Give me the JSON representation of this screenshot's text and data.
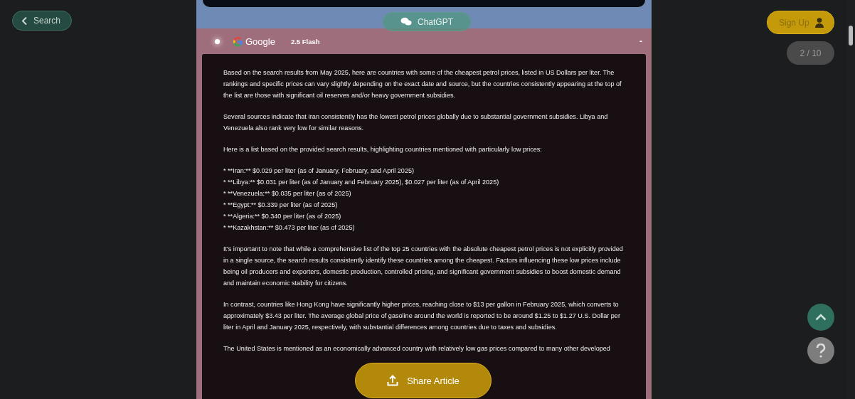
{
  "back_button": {
    "label": "Search"
  },
  "model_tab": {
    "label": "ChatGPT"
  },
  "response_header": {
    "provider": "Google",
    "model": "2.5 Flash",
    "collapse": "-"
  },
  "response_blocks": [
    {
      "kind": "paragraph",
      "text": "Based on the search results from May 2025, here are countries with some of the cheapest petrol prices, listed in US Dollars per liter. The rankings and specific prices can vary slightly depending on the exact date and source, but the countries consistently appearing at the top of the list are those with significant oil reserves and/or heavy government subsidies."
    },
    {
      "kind": "paragraph",
      "text": "Several sources indicate that Iran consistently has the lowest petrol prices globally due to substantial government subsidies. Libya and Venezuela also rank very low for similar reasons."
    },
    {
      "kind": "paragraph",
      "text": "Here is a list based on the provided search results, highlighting countries mentioned with particularly low prices:"
    },
    {
      "kind": "list",
      "items": [
        "* **Iran:** $0.029 per liter (as of January, February, and April 2025)",
        "* **Libya:** $0.031 per liter (as of January and February 2025), $0.027 per liter (as of April 2025)",
        "* **Venezuela:** $0.035 per liter (as of 2025)",
        "* **Egypt:** $0.339 per liter (as of 2025)",
        "* **Algeria:** $0.340 per liter (as of 2025)",
        "* **Kazakhstan:** $0.473 per liter (as of 2025)"
      ]
    },
    {
      "kind": "paragraph",
      "text": "It's important to note that while a comprehensive list of the top 25 countries with the absolute cheapest petrol prices is not explicitly provided in a single source, the search results consistently identify these countries among the cheapest. Factors influencing these low prices include being oil producers and exporters, domestic production, controlled pricing, and significant government subsidies to boost domestic demand and maintain economic stability for citizens."
    },
    {
      "kind": "paragraph",
      "text": "In contrast, countries like Hong Kong have significantly higher prices, reaching close to $13 per gallon in February 2025, which converts to approximately $3.43 per liter. The average global price of gasoline around the world is reported to be around $1.25 to $1.27 U.S. Dollar per liter in April and January 2025, respectively, with substantial differences among countries due to taxes and subsidies."
    },
    {
      "kind": "paragraph",
      "text": "The United States is mentioned as an economically advanced country with relatively low gas prices compared to many other developed"
    }
  ],
  "sign_up_button": {
    "label": "Sign Up"
  },
  "page_counter": "2 / 10",
  "share_button": {
    "label": "Share Article"
  }
}
